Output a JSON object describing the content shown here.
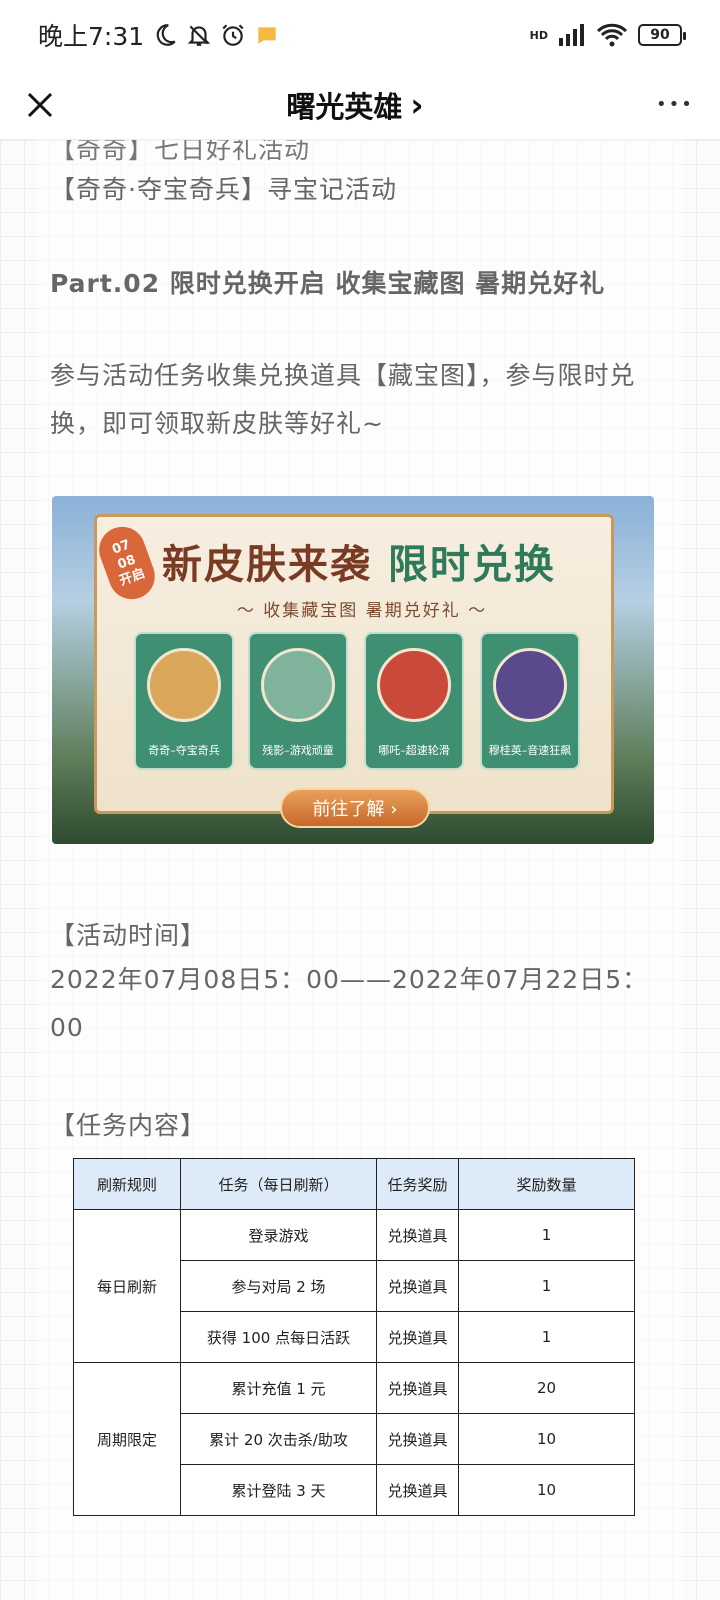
{
  "status_bar": {
    "time": "晚上7:31",
    "network": "HD",
    "battery": "90"
  },
  "nav": {
    "title": "曙光英雄",
    "title_chevron": "›",
    "more": "•••"
  },
  "article": {
    "partial_line": "【奇奇】七日好礼活动",
    "line_xunbao": "【奇奇·夺宝奇兵】寻宝记活动",
    "part2_heading": "Part.02 限时兑换开启 收集宝藏图 暑期兑好礼",
    "part2_desc": "参与活动任务收集兑换道具【藏宝图】，参与限时兑换，即可领取新皮肤等好礼~",
    "banner": {
      "badge_date": "07\n08\n开启",
      "title_a": "新皮肤来袭",
      "title_b": "限时兑换",
      "subtitle": "～ 收集藏宝图  暑期兑好礼 ～",
      "skins": [
        {
          "label": "奇奇–夺宝奇兵",
          "color": "#d9a65a"
        },
        {
          "label": "残影–游戏顽童",
          "color": "#7fb39c"
        },
        {
          "label": "哪吒–超速轮滑",
          "color": "#c9493a"
        },
        {
          "label": "穆桂英–音速狂飙",
          "color": "#5a4a8c"
        }
      ],
      "button": "前往了解 ›"
    },
    "time_heading": "【活动时间】",
    "time_value": "2022年07月08日5：00——2022年07月22日5：00",
    "task_heading": "【任务内容】",
    "task_table": {
      "headers": [
        "刷新规则",
        "任务（每日刷新）",
        "任务奖励",
        "奖励数量"
      ],
      "groups": [
        {
          "rule": "每日刷新",
          "rows": [
            {
              "task": "登录游戏",
              "reward": "兑换道具",
              "qty": "1"
            },
            {
              "task": "参与对局 2 场",
              "reward": "兑换道具",
              "qty": "1"
            },
            {
              "task": "获得 100 点每日活跃",
              "reward": "兑换道具",
              "qty": "1"
            }
          ]
        },
        {
          "rule": "周期限定",
          "rows": [
            {
              "task": "累计充值 1 元",
              "reward": "兑换道具",
              "qty": "20"
            },
            {
              "task": "累计 20 次击杀/助攻",
              "reward": "兑换道具",
              "qty": "10"
            },
            {
              "task": "累计登陆 3 天",
              "reward": "兑换道具",
              "qty": "10"
            }
          ]
        }
      ]
    }
  }
}
